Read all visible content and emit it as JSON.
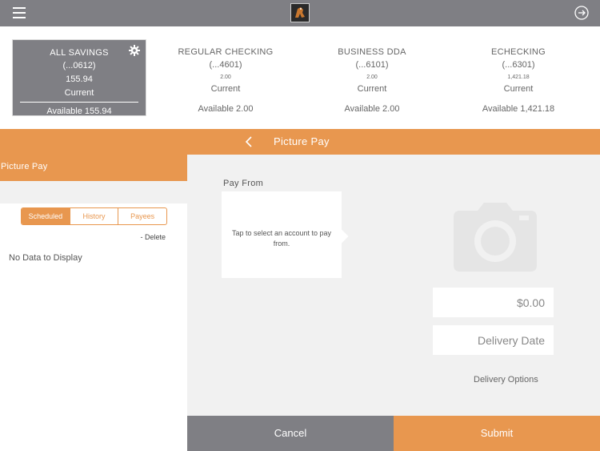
{
  "topbar": {
    "menu_icon": "menu-icon",
    "logo_icon": "bank-logo-icon",
    "logout_icon": "logout-icon"
  },
  "accounts": [
    {
      "name": "ALL SAVINGS",
      "number": "(...0612)",
      "balance": "155.94",
      "status": "Current",
      "available": "Available 155.94",
      "selected": true
    },
    {
      "name": "REGULAR CHECKING",
      "number": "(...4601)",
      "balance": "2.00",
      "status": "Current",
      "available": "Available 2.00",
      "selected": false
    },
    {
      "name": "BUSINESS DDA",
      "number": "(...6101)",
      "balance": "2.00",
      "status": "Current",
      "available": "Available 2.00",
      "selected": false
    },
    {
      "name": "ECHECKING",
      "number": "(...6301)",
      "balance": "1,421.18",
      "status": "Current",
      "available": "Available 1,421.18",
      "selected": false
    }
  ],
  "header": {
    "title": "Picture Pay"
  },
  "left": {
    "title": "Picture Pay",
    "tabs": [
      "Scheduled",
      "History",
      "Payees"
    ],
    "active_tab": "Scheduled",
    "delete_label": "- Delete",
    "empty_message": "No Data to Display"
  },
  "form": {
    "pay_from_label": "Pay From",
    "pay_from_prompt": "Tap to select an account to pay from.",
    "amount_placeholder": "$0.00",
    "date_placeholder": "Delivery Date",
    "delivery_options": "Delivery Options"
  },
  "footer": {
    "cancel_label": "Cancel",
    "submit_label": "Submit"
  },
  "colors": {
    "accent": "#e8974f",
    "gray": "#7f7f84",
    "panel": "#f1f1f1"
  }
}
